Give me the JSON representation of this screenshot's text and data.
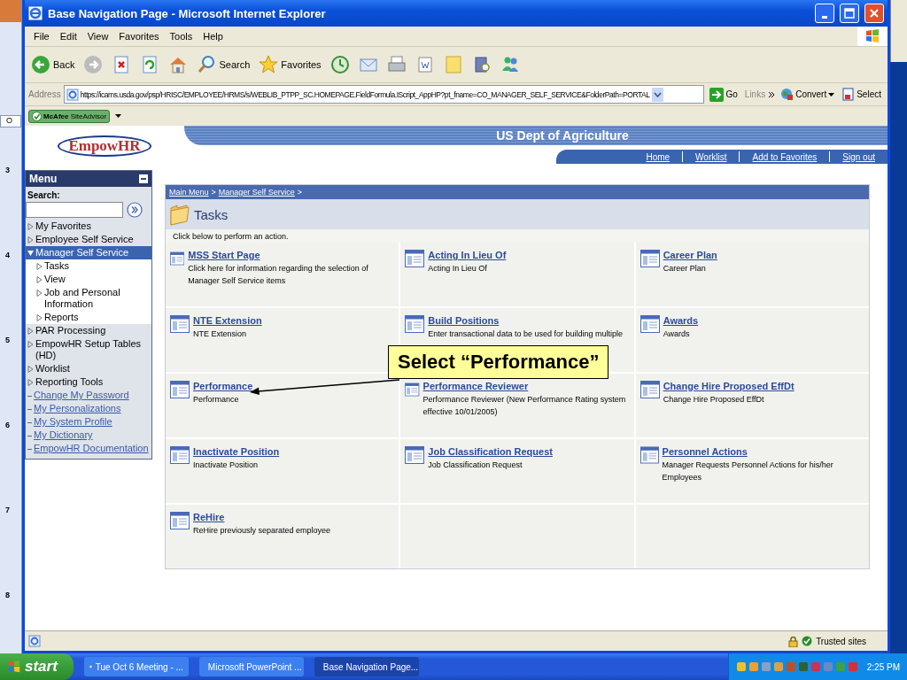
{
  "window": {
    "title": "Base Navigation Page - Microsoft Internet Explorer"
  },
  "menu_bar": [
    "File",
    "Edit",
    "View",
    "Favorites",
    "Tools",
    "Help"
  ],
  "toolbar": [
    {
      "kind": "back",
      "label": "Back"
    },
    {
      "kind": "forward"
    },
    {
      "kind": "stop"
    },
    {
      "kind": "refresh"
    },
    {
      "kind": "home"
    },
    {
      "kind": "search",
      "label": "Search"
    },
    {
      "kind": "favorites",
      "label": "Favorites"
    },
    {
      "kind": "history"
    },
    {
      "kind": "mail"
    },
    {
      "kind": "print"
    },
    {
      "kind": "word"
    },
    {
      "kind": "note"
    },
    {
      "kind": "research"
    },
    {
      "kind": "messenger"
    }
  ],
  "address_bar": {
    "label": "Address",
    "url": "https://icams.usda.gov/psp/HRISC/EMPLOYEE/HRMS/s/WEBLIB_PTPP_SC.HOMEPAGE.FieldFormula.IScript_AppHP?pt_fname=CO_MANAGER_SELF_SERVICE&FolderPath=PORTAL",
    "go": "Go",
    "links": "Links",
    "convert": "Convert",
    "select": "Select"
  },
  "site_advisor": {
    "label": "**McAfee** SiteAdvisor"
  },
  "background_app": {
    "tab": "O",
    "slide_numbers": [
      "3",
      "4",
      "5",
      "6",
      "7",
      "8"
    ]
  },
  "page": {
    "logo": "EmpowHR",
    "agency": "US Dept of Agriculture",
    "nav": [
      "Home",
      "Worklist",
      "Add to Favorites",
      "Sign out"
    ],
    "menu": {
      "title": "Menu",
      "search_label": "Search:",
      "items": [
        {
          "label": "My Favorites",
          "kind": "folder",
          "expanded": false,
          "selected": false
        },
        {
          "label": "Employee Self Service",
          "kind": "folder",
          "expanded": false,
          "selected": false
        },
        {
          "label": "Manager Self Service",
          "kind": "folder",
          "expanded": true,
          "selected": true,
          "children": [
            {
              "label": "Tasks",
              "kind": "folder",
              "expanded": false,
              "selected": false
            },
            {
              "label": "View",
              "kind": "folder",
              "expanded": false,
              "selected": false
            },
            {
              "label": "Job and Personal Information",
              "kind": "folder",
              "expanded": false,
              "selected": false
            },
            {
              "label": "Reports",
              "kind": "folder",
              "expanded": false,
              "selected": false
            }
          ]
        },
        {
          "label": "PAR Processing",
          "kind": "folder",
          "expanded": false,
          "selected": false
        },
        {
          "label": "EmpowHR Setup Tables (HD)",
          "kind": "folder",
          "expanded": false,
          "selected": false
        },
        {
          "label": "Worklist",
          "kind": "folder",
          "expanded": false,
          "selected": false
        },
        {
          "label": "Reporting Tools",
          "kind": "folder",
          "expanded": false,
          "selected": false
        },
        {
          "label": "Change My Password",
          "kind": "link",
          "selected": false
        },
        {
          "label": "My Personalizations",
          "kind": "link",
          "selected": false
        },
        {
          "label": "My System Profile",
          "kind": "link",
          "selected": false
        },
        {
          "label": "My Dictionary",
          "kind": "link",
          "selected": false
        },
        {
          "label": "EmpowHR Documentation",
          "kind": "link",
          "selected": false
        }
      ]
    },
    "breadcrumb": {
      "links": [
        "Main Menu",
        "Manager Self Service"
      ],
      "separator": ">"
    },
    "heading": "Tasks",
    "instruction": "Click below to perform an action.",
    "tasks": [
      {
        "title": "MSS Start Page",
        "description": "Click here for information regarding the selection of Manager Self Service items"
      },
      {
        "title": "Acting In Lieu Of",
        "description": "Acting In Lieu Of"
      },
      {
        "title": "Career Plan",
        "description": "Career Plan"
      },
      {
        "title": "NTE Extension",
        "description": "NTE Extension"
      },
      {
        "title": "Build Positions",
        "description": "Enter transactional data to be used for building multiple"
      },
      {
        "title": "Awards",
        "description": "Awards"
      },
      {
        "title": "Performance",
        "description": "Performance"
      },
      {
        "title": "Performance Reviewer",
        "description": "Performance Reviewer (New Performance Rating system effective 10/01/2005)"
      },
      {
        "title": "Change Hire Proposed EffDt",
        "description": "Change Hire Proposed EffDt"
      },
      {
        "title": "Inactivate Position",
        "description": "Inactivate Position"
      },
      {
        "title": "Job Classification Request",
        "description": "Job Classification Request"
      },
      {
        "title": "Personnel Actions",
        "description": "Manager Requests Personnel Actions for his/her Employees"
      },
      {
        "title": "ReHire",
        "description": "ReHire previously separated employee"
      }
    ],
    "callout": "Select “Performance”"
  },
  "status_bar": {
    "zone": "Trusted sites"
  },
  "taskbar": {
    "start": "start",
    "tasks": [
      {
        "label": "Tue Oct 6 Meeting - ...",
        "kind": "outlook",
        "selected": false
      },
      {
        "label": "Microsoft PowerPoint ...",
        "kind": "powerpoint",
        "selected": false
      },
      {
        "label": "Base Navigation Page...",
        "kind": "browser",
        "selected": true
      }
    ],
    "clock": "2:25 PM"
  }
}
